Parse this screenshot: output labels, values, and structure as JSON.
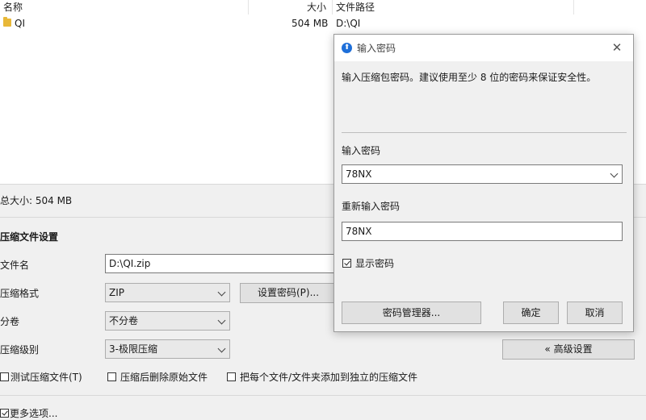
{
  "filelist": {
    "columns": {
      "name": "名称",
      "size": "大小",
      "path": "文件路径"
    },
    "rows": [
      {
        "name": "QI",
        "size": "504 MB",
        "path": "D:\\QI"
      }
    ]
  },
  "summary": {
    "total_size": "总大小: 504 MB"
  },
  "settings": {
    "section_title": "压缩文件设置",
    "filename_label": "文件名",
    "filename_value": "D:\\QI.zip",
    "format_label": "压缩格式",
    "format_value": "ZIP",
    "set_password_button": "设置密码(P)...",
    "volume_label": "分卷",
    "volume_value": "不分卷",
    "level_label": "压缩级别",
    "level_value": "3-极限压缩",
    "advanced_button": "« 高级设置",
    "options": [
      {
        "label": "测试压缩文件(T)",
        "checked": false
      },
      {
        "label": "压缩后删除原始文件",
        "checked": false
      },
      {
        "label": "把每个文件/文件夹添加到独立的压缩文件",
        "checked": false
      }
    ],
    "more_options": "更多选项..."
  },
  "dialog": {
    "title": "输入密码",
    "description": "输入压缩包密码。建议使用至少 8 位的密码来保证安全性。",
    "password_label": "输入密码",
    "password_value": "78NX",
    "reenter_label": "重新输入密码",
    "reenter_value": "78NX",
    "show_password_label": "显示密码",
    "show_password_checked": true,
    "password_manager_button": "密码管理器...",
    "ok_button": "确定",
    "cancel_button": "取消"
  },
  "colors": {
    "accent": "#1e6fd9",
    "folder": "#e8b838"
  }
}
